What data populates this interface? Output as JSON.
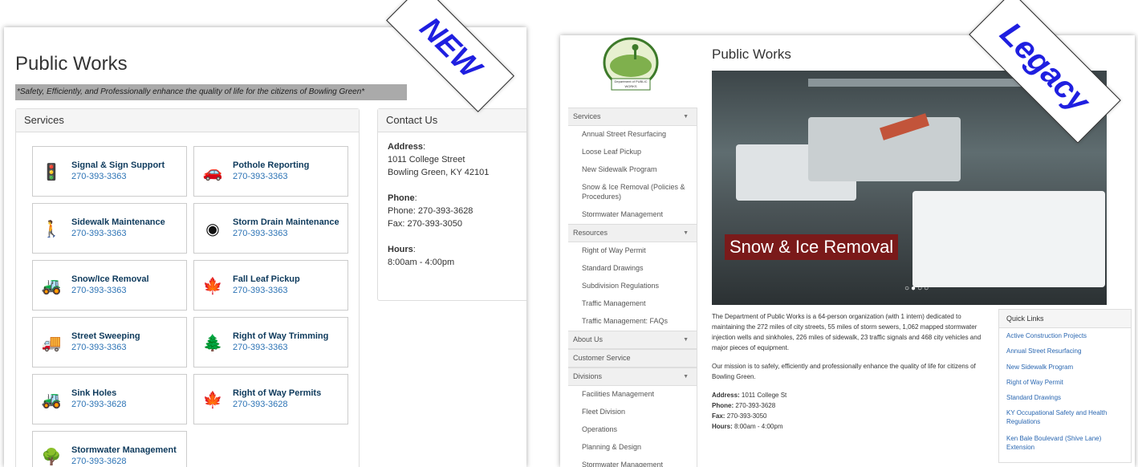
{
  "new": {
    "title": "Public Works",
    "tagline": "*Safety, Efficiently, and Professionally enhance the quality of life for the citizens of Bowling Green*",
    "services_heading": "Services",
    "services": [
      {
        "name": "Signal & Sign Support",
        "phone": "270-393-3363",
        "icon": "traffic-light-icon",
        "glyph": "🚦"
      },
      {
        "name": "Pothole Reporting",
        "phone": "270-393-3363",
        "icon": "car-crash-icon",
        "glyph": "🚗"
      },
      {
        "name": "Sidewalk Maintenance",
        "phone": "270-393-3363",
        "icon": "walking-icon",
        "glyph": "🚶"
      },
      {
        "name": "Storm Drain Maintenance",
        "phone": "270-393-3363",
        "icon": "drain-icon",
        "glyph": "◉"
      },
      {
        "name": "Snow/Ice Removal",
        "phone": "270-393-3363",
        "icon": "bulldozer-icon",
        "glyph": "🚜"
      },
      {
        "name": "Fall Leaf Pickup",
        "phone": "270-393-3363",
        "icon": "maple-leaf-icon",
        "glyph": "🍁"
      },
      {
        "name": "Street Sweeping",
        "phone": "270-393-3363",
        "icon": "truck-icon",
        "glyph": "🚚"
      },
      {
        "name": "Right of Way Trimming",
        "phone": "270-393-3363",
        "icon": "trees-icon",
        "glyph": "🌲"
      },
      {
        "name": "Sink Holes",
        "phone": "270-393-3628",
        "icon": "bulldozer-icon",
        "glyph": "🚜"
      },
      {
        "name": "Right of Way Permits",
        "phone": "270-393-3628",
        "icon": "maple-leaf-icon",
        "glyph": "🍁"
      },
      {
        "name": "Stormwater Management",
        "phone": "270-393-3628",
        "icon": "tree-bench-icon",
        "glyph": "🌳"
      }
    ],
    "contact": {
      "heading": "Contact Us",
      "address_label": "Address",
      "address_line1": "1011 College Street",
      "address_line2": "Bowling Green, KY 42101",
      "phone_label": "Phone",
      "phone": "Phone: 270-393-3628",
      "fax": "Fax: 270-393-3050",
      "hours_label": "Hours",
      "hours": "8:00am - 4:00pm"
    },
    "banner": "NEW"
  },
  "legacy": {
    "title": "Public Works",
    "logo_text": "Department of PUBLIC WORKS",
    "banner": "Legacy",
    "sidebar": [
      {
        "type": "head",
        "label": "Services",
        "caret": true
      },
      {
        "type": "item",
        "label": "Annual Street Resurfacing"
      },
      {
        "type": "item",
        "label": "Loose Leaf Pickup"
      },
      {
        "type": "item",
        "label": "New Sidewalk Program"
      },
      {
        "type": "item",
        "label": "Snow & Ice Removal (Policies &"
      },
      {
        "type": "item",
        "label": "Procedures)"
      },
      {
        "type": "item",
        "label": "Stormwater Management"
      },
      {
        "type": "head",
        "label": "Resources",
        "caret": true
      },
      {
        "type": "item",
        "label": "Right of Way Permit"
      },
      {
        "type": "item",
        "label": "Standard Drawings"
      },
      {
        "type": "item",
        "label": "Subdivision Regulations"
      },
      {
        "type": "item",
        "label": "Traffic Management"
      },
      {
        "type": "item",
        "label": "Traffic Management: FAQs"
      },
      {
        "type": "head",
        "label": "About Us",
        "caret": true
      },
      {
        "type": "head",
        "label": "Customer Service",
        "caret": false
      },
      {
        "type": "head",
        "label": "Divisions",
        "caret": true
      },
      {
        "type": "item",
        "label": "Facilities Management"
      },
      {
        "type": "item",
        "label": "Fleet Division"
      },
      {
        "type": "item",
        "label": "Operations"
      },
      {
        "type": "item",
        "label": "Planning & Design"
      },
      {
        "type": "item",
        "label": "Stormwater Management"
      }
    ],
    "slide_caption": "Snow & Ice Removal",
    "carousel_dots": "○●○○",
    "body_p1": "The Department of Public Works is a 64-person organization (with 1 intern) dedicated to maintaining the 272 miles of city streets, 55 miles of storm sewers, 1,062 mapped stormwater injection wells and sinkholes, 226 miles of sidewalk, 23 traffic signals and 468 city vehicles and major pieces of equipment.",
    "body_p2": "Our mission is to safely, efficiently and professionally enhance the quality of life for citizens of Bowling Green.",
    "address_label": "Address:",
    "address": "1011 College St",
    "phone_label": "Phone:",
    "phone": "270-393-3628",
    "fax_label": "Fax:",
    "fax": "270-393-3050",
    "hours_label": "Hours:",
    "hours": "8:00am - 4:00pm",
    "quick_links_heading": "Quick Links",
    "quick_links": [
      "Active Construction Projects",
      "Annual Street Resurfacing",
      "New Sidewalk Program",
      "Right of Way Permit",
      "Standard Drawings",
      "KY Occupational Safety and Health Regulations",
      "Ken Bale Boulevard (Shive Lane) Extension"
    ]
  }
}
